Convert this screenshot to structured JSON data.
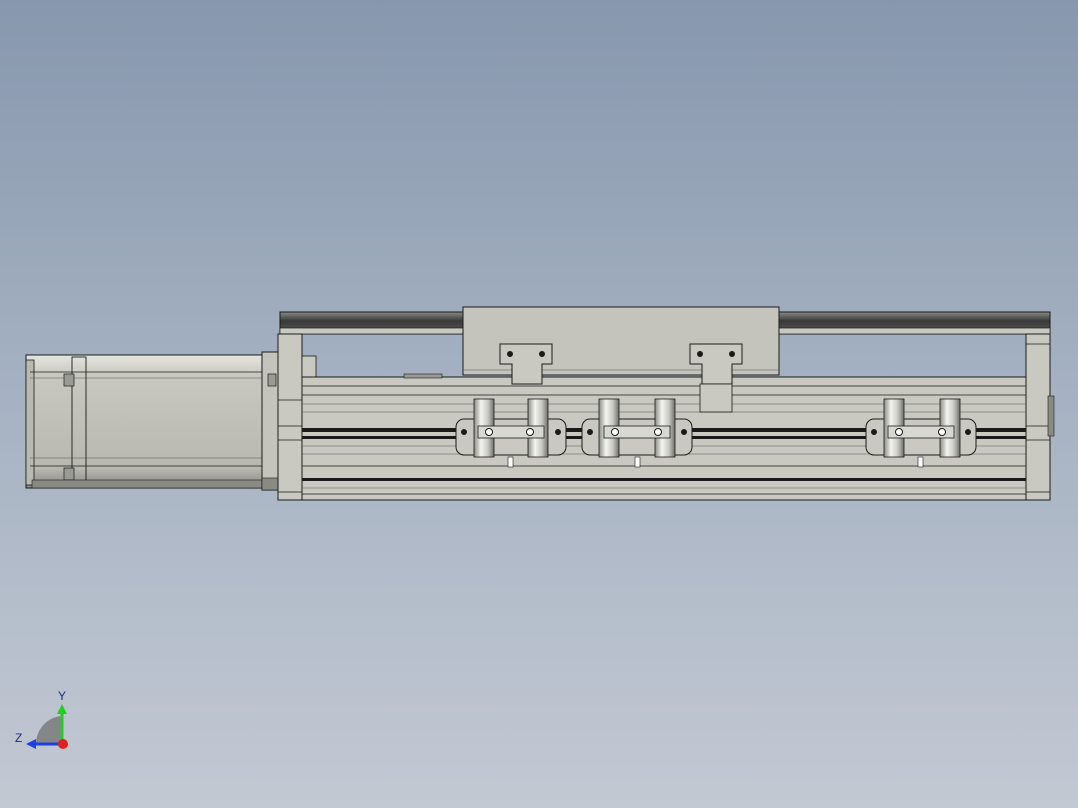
{
  "viewport": {
    "background_top": "#8797ad",
    "background_bottom": "#c3c9d3"
  },
  "model": {
    "body_color": "#c9c9c1",
    "edge_color": "#1a1a1a",
    "dark_color": "#3a3a3a",
    "components": [
      "servo-motor",
      "motor-flange",
      "guide-rod",
      "top-plate",
      "linear-module-body",
      "slider-blocks",
      "end-plate"
    ]
  },
  "triad": {
    "y_label": "Y",
    "z_label": "Z",
    "y_color": "#1fd11f",
    "z_color": "#1f3fe0",
    "x_color": "#e01f1f"
  }
}
